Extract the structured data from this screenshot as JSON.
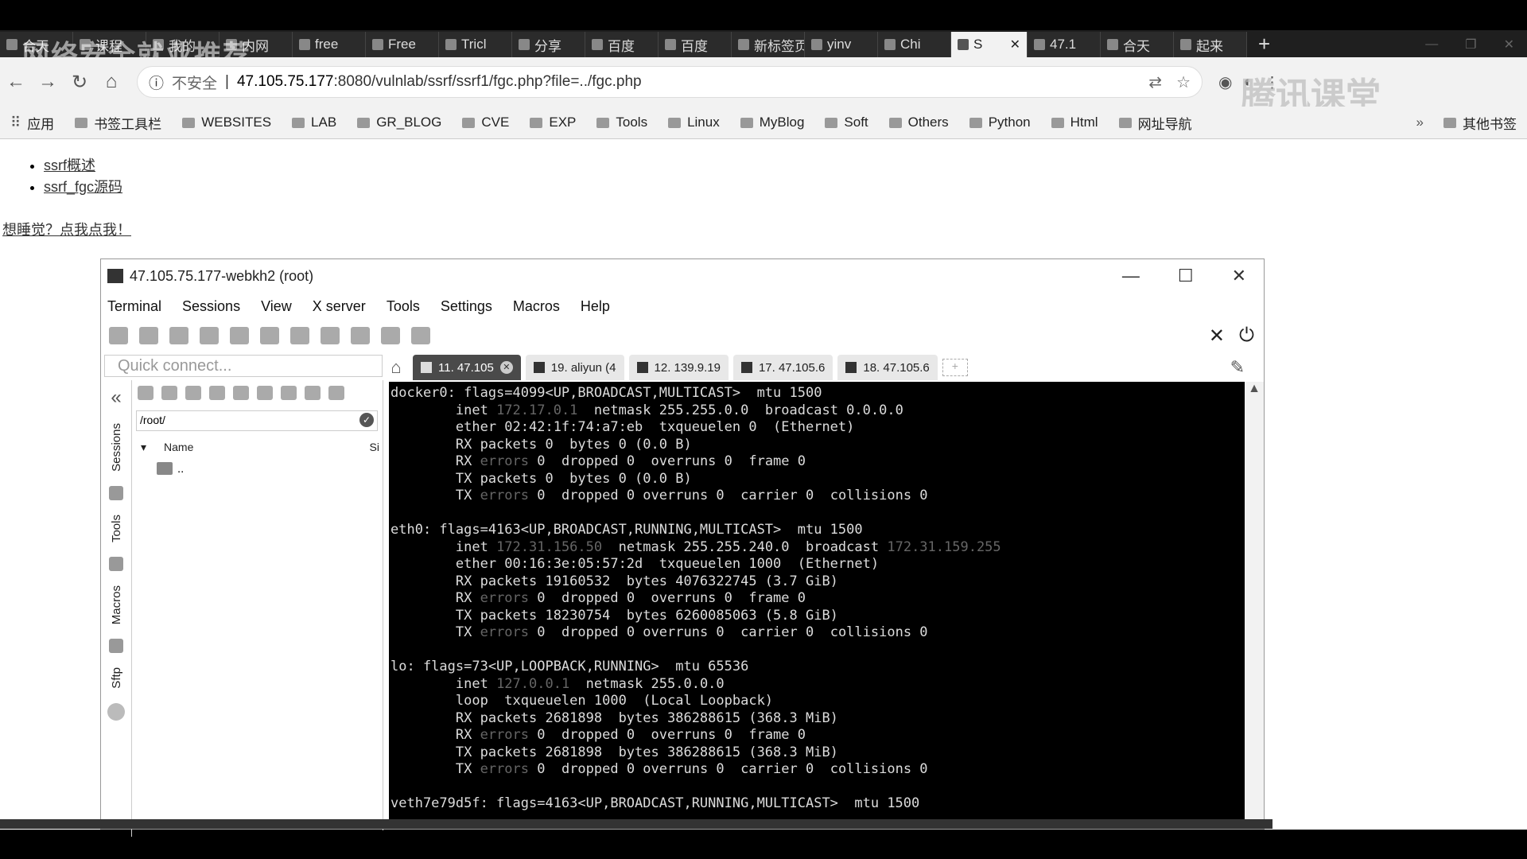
{
  "browser": {
    "tabs": [
      {
        "label": "合天",
        "active": false
      },
      {
        "label": "课程",
        "active": false
      },
      {
        "label": "我的",
        "active": false
      },
      {
        "label": "内网",
        "active": false
      },
      {
        "label": "free",
        "active": false
      },
      {
        "label": "Free",
        "active": false
      },
      {
        "label": "Tricl",
        "active": false
      },
      {
        "label": "分享",
        "active": false
      },
      {
        "label": "百度",
        "active": false
      },
      {
        "label": "百度",
        "active": false
      },
      {
        "label": "新标签页",
        "active": false
      },
      {
        "label": "yinv",
        "active": false
      },
      {
        "label": "Chi",
        "active": false
      },
      {
        "label": "S",
        "active": true
      },
      {
        "label": "47.1",
        "active": false
      },
      {
        "label": "合天",
        "active": false
      },
      {
        "label": "起来",
        "active": false
      }
    ],
    "new_tab": "+",
    "watermark_left": "网络安全就业推荐",
    "watermark_right": "腾讯课堂",
    "address": {
      "insecure_label": "不安全",
      "host": "47.105.75.177",
      "path": ":8080/vulnlab/ssrf/ssrf1/fgc.php?file=../fgc.php"
    },
    "bookmarks": [
      {
        "label": "应用",
        "icon": "apps-grid-icon"
      },
      {
        "label": "书签工具栏",
        "icon": "folder-icon"
      },
      {
        "label": "WEBSITES",
        "icon": "folder-icon"
      },
      {
        "label": "LAB",
        "icon": "folder-icon"
      },
      {
        "label": "GR_BLOG",
        "icon": "folder-icon"
      },
      {
        "label": "CVE",
        "icon": "folder-icon"
      },
      {
        "label": "EXP",
        "icon": "folder-icon"
      },
      {
        "label": "Tools",
        "icon": "folder-icon"
      },
      {
        "label": "Linux",
        "icon": "folder-icon"
      },
      {
        "label": "MyBlog",
        "icon": "folder-icon"
      },
      {
        "label": "Soft",
        "icon": "folder-icon"
      },
      {
        "label": "Others",
        "icon": "folder-icon"
      },
      {
        "label": "Python",
        "icon": "folder-icon"
      },
      {
        "label": "Html",
        "icon": "folder-icon"
      },
      {
        "label": "网址导航",
        "icon": "folder-icon"
      }
    ],
    "bookmarks_more": "»",
    "other_bookmarks": "其他书签"
  },
  "page": {
    "links": [
      "ssrf概述",
      "ssrf_fgc源码"
    ],
    "sleep_link": "想睡觉？点我点我！"
  },
  "moba": {
    "title": "47.105.75.177-webkh2 (root)",
    "menu": [
      "Terminal",
      "Sessions",
      "View",
      "X server",
      "Tools",
      "Settings",
      "Macros",
      "Help"
    ],
    "quick_connect_placeholder": "Quick connect...",
    "session_tabs": [
      {
        "label": "11. 47.105",
        "active": true
      },
      {
        "label": "19. aliyun (4",
        "active": false
      },
      {
        "label": "12. 139.9.19",
        "active": false
      },
      {
        "label": "17. 47.105.6",
        "active": false
      },
      {
        "label": "18. 47.105.6",
        "active": false
      }
    ],
    "side_tabs": [
      "Sessions",
      "Tools",
      "Macros",
      "Sftp"
    ],
    "sftp": {
      "path": "/root/",
      "col_name": "Name",
      "col_size": "Si",
      "parent_dir": ".."
    },
    "terminal_lines": [
      [
        "docker0: flags=4099<UP,BROADCAST,MULTICAST>  mtu 1500"
      ],
      [
        "        inet ",
        {
          "dim": "172.17.0.1"
        },
        "  netmask 255.255.0.0  broadcast 0.0.0.0"
      ],
      [
        "        ether 02:42:1f:74:a7:eb  txqueuelen 0  (Ethernet)"
      ],
      [
        "        RX packets 0  bytes 0 (0.0 B)"
      ],
      [
        "        RX ",
        {
          "dim": "errors"
        },
        " 0  dropped 0  overruns 0  frame 0"
      ],
      [
        "        TX packets 0  bytes 0 (0.0 B)"
      ],
      [
        "        TX ",
        {
          "dim": "errors"
        },
        " 0  dropped 0 overruns 0  carrier 0  collisions 0"
      ],
      [
        ""
      ],
      [
        "eth0: flags=4163<UP,BROADCAST,RUNNING,MULTICAST>  mtu 1500"
      ],
      [
        "        inet ",
        {
          "dim": "172.31.156.50"
        },
        "  netmask 255.255.240.0  broadcast ",
        {
          "dim": "172.31.159.255"
        }
      ],
      [
        "        ether 00:16:3e:05:57:2d  txqueuelen 1000  (Ethernet)"
      ],
      [
        "        RX packets 19160532  bytes 4076322745 (3.7 GiB)"
      ],
      [
        "        RX ",
        {
          "dim": "errors"
        },
        " 0  dropped 0  overruns 0  frame 0"
      ],
      [
        "        TX packets 18230754  bytes 6260085063 (5.8 GiB)"
      ],
      [
        "        TX ",
        {
          "dim": "errors"
        },
        " 0  dropped 0 overruns 0  carrier 0  collisions 0"
      ],
      [
        ""
      ],
      [
        "lo: flags=73<UP,LOOPBACK,RUNNING>  mtu 65536"
      ],
      [
        "        inet ",
        {
          "dim": "127.0.0.1"
        },
        "  netmask 255.0.0.0"
      ],
      [
        "        loop  txqueuelen 1000  (Local Loopback)"
      ],
      [
        "        RX packets 2681898  bytes 386288615 (368.3 MiB)"
      ],
      [
        "        RX ",
        {
          "dim": "errors"
        },
        " 0  dropped 0  overruns 0  frame 0"
      ],
      [
        "        TX packets 2681898  bytes 386288615 (368.3 MiB)"
      ],
      [
        "        TX ",
        {
          "dim": "errors"
        },
        " 0  dropped 0 overruns 0  carrier 0  collisions 0"
      ],
      [
        ""
      ],
      [
        "veth7e79d5f: flags=4163<UP,BROADCAST,RUNNING,MULTICAST>  mtu 1500"
      ]
    ]
  }
}
